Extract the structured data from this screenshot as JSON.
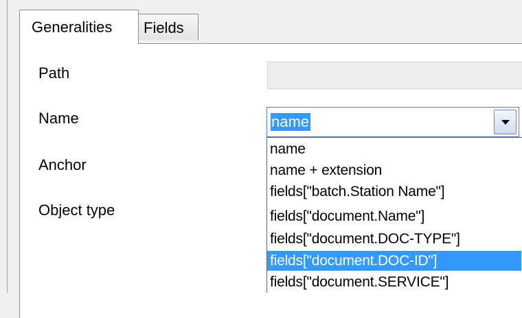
{
  "tabs": [
    {
      "label": "Generalities",
      "active": true
    },
    {
      "label": "Fields",
      "active": false
    }
  ],
  "form": {
    "path_label": "Path",
    "path_value": "",
    "name_label": "Name",
    "name_value": "name",
    "anchor_label": "Anchor",
    "object_type_label": "Object type"
  },
  "dropdown": {
    "options": [
      "name",
      "name + extension",
      "fields[\"batch.Station Name\"]",
      "fields[\"document.Name\"]",
      "fields[\"document.DOC-TYPE\"]",
      "fields[\"document.DOC-ID\"]",
      "fields[\"document.SERVICE\"]"
    ],
    "highlighted_option": "fields[\"document.DOC-ID\"]"
  },
  "icons": {
    "dropdown_button": "chevron-down-icon"
  },
  "colors": {
    "selection": "#3399ff",
    "combo_border": "#5c7ac0",
    "panel_background": "#ffffff",
    "window_background": "#f0f0f0"
  }
}
